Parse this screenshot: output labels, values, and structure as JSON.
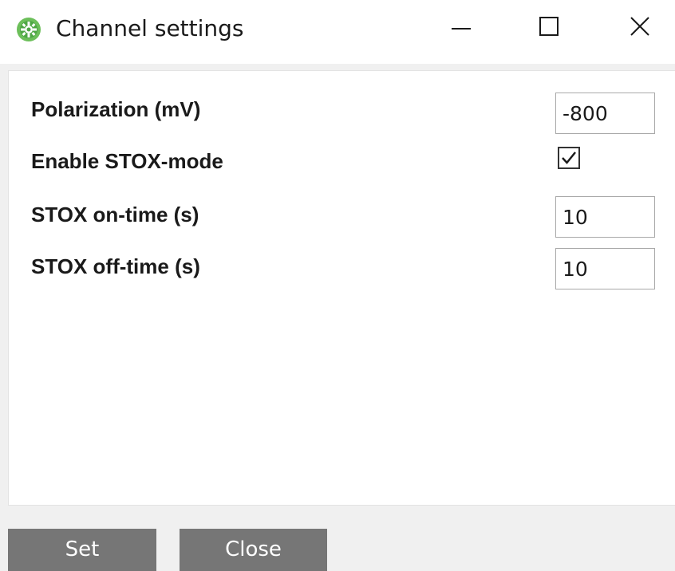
{
  "window": {
    "title": "Channel settings",
    "icon": "green-gear-app-icon"
  },
  "window_controls": {
    "minimize_icon": "minimize-icon",
    "maximize_icon": "maximize-icon",
    "close_icon": "close-icon"
  },
  "settings": {
    "polarization": {
      "label": "Polarization (mV)",
      "value": "-800"
    },
    "stox_mode": {
      "label": "Enable STOX-mode",
      "checked": true
    },
    "stox_on_time": {
      "label": "STOX on-time (s)",
      "value": "10"
    },
    "stox_off_time": {
      "label": "STOX off-time (s)",
      "value": "10"
    }
  },
  "buttons": {
    "set_label": "Set",
    "close_label": "Close"
  },
  "colors": {
    "app_icon_green": "#5cb85c",
    "button_gray": "#767676",
    "panel_bg": "#ffffff",
    "window_bg": "#f0f0f0"
  }
}
